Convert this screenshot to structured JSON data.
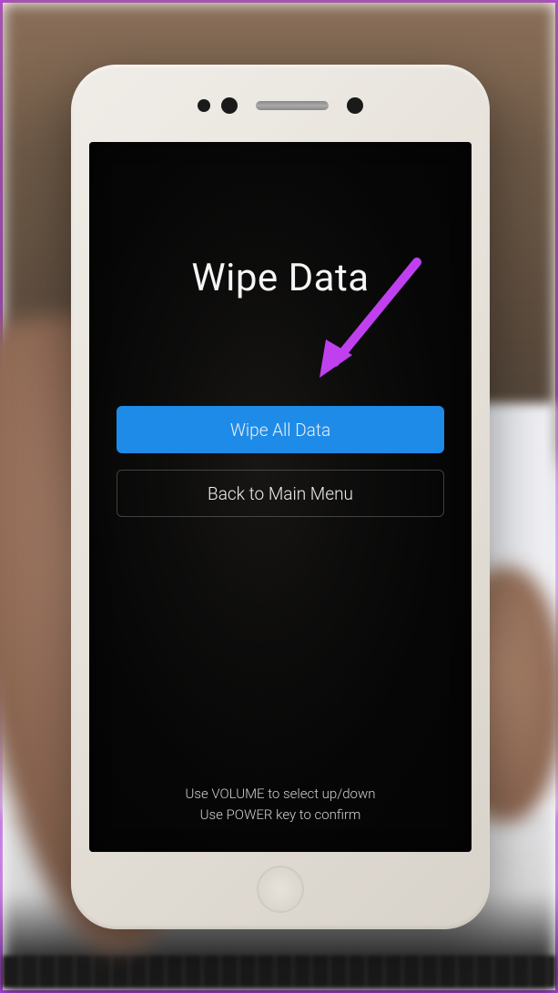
{
  "screen": {
    "title": "Wipe Data",
    "menu": [
      {
        "label": "Wipe All Data",
        "selected": true
      },
      {
        "label": "Back to Main Menu",
        "selected": false
      }
    ],
    "hints": {
      "line1": "Use VOLUME to select up/down",
      "line2": "Use POWER key to confirm"
    }
  },
  "annotation": {
    "arrow_color": "#c040f0"
  }
}
